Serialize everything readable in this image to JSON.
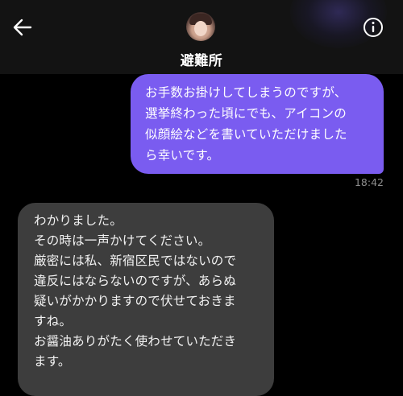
{
  "header": {
    "contact_name": "避難所",
    "back_icon": "arrow-left-icon",
    "info_icon": "info-circle-icon",
    "background": "#131313"
  },
  "messages": {
    "sent": {
      "lines": [
        "お手数お掛けしてしまうのですが、",
        "選挙終わった頃にでも、アイコンの",
        "似顔絵などを書いていただけました",
        "ら幸いです。"
      ],
      "time": "18:42",
      "color": "#7a5cf0"
    },
    "received": {
      "lines": [
        "わかりました。",
        "その時は一声かけてください。",
        "厳密には私、新宿区民ではないので",
        "違反にはならないのですが、あらぬ",
        "疑いがかかりますので伏せておきま",
        "すね。",
        "お醤油ありがたく使わせていただき",
        "ます。"
      ],
      "color": "#3d3d3d"
    }
  }
}
